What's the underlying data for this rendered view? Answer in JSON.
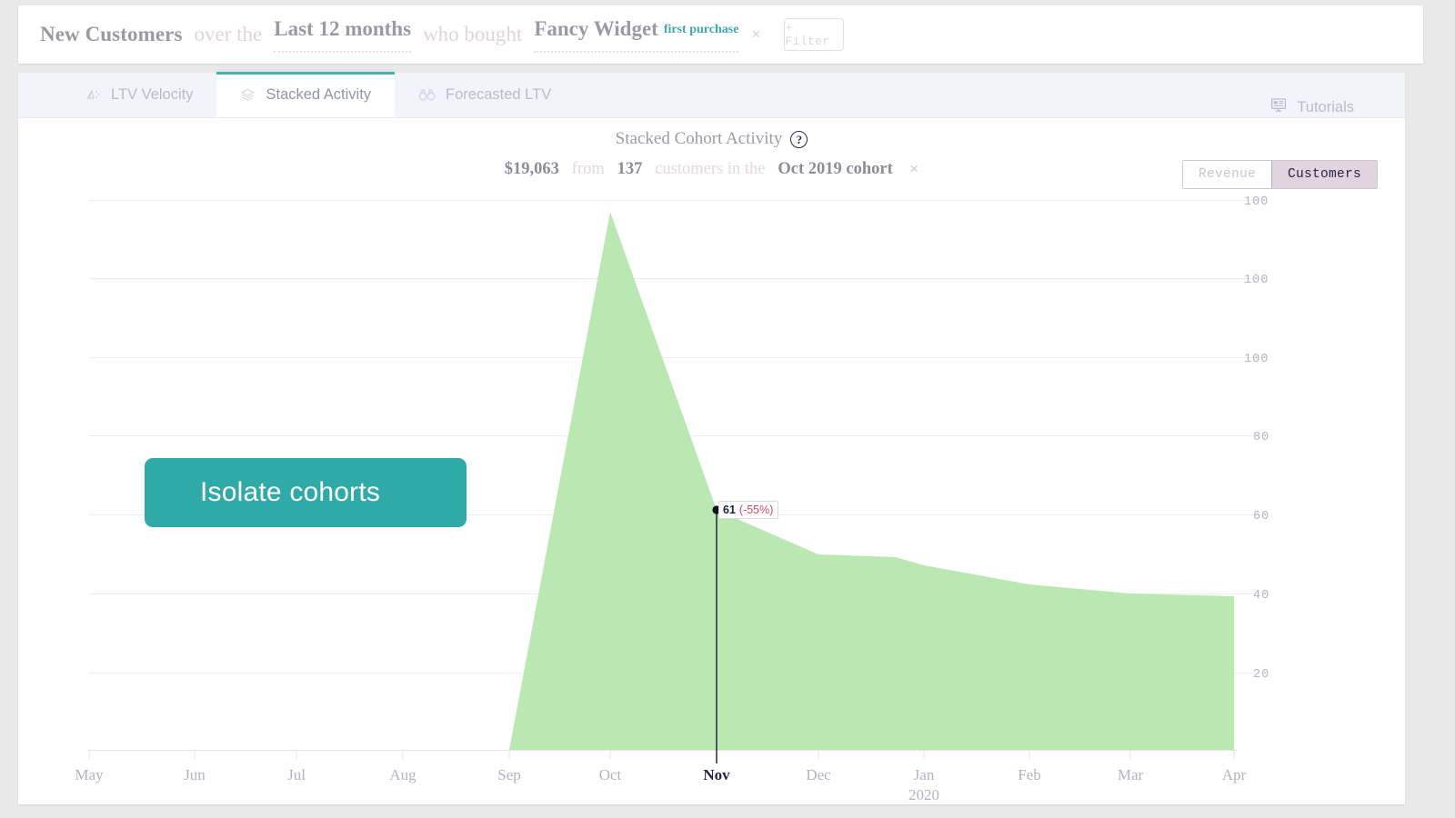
{
  "query_bar": {
    "metric": "New Customers",
    "conn1": "over the",
    "period": "Last 12 months",
    "conn2": "who bought",
    "product": "Fancy Widget",
    "product_sub": "first purchase",
    "remove": "×",
    "filter_button": "+ Filter"
  },
  "tabs": {
    "items": [
      {
        "label": "LTV Velocity",
        "icon": "ltv-velocity-icon",
        "active": false
      },
      {
        "label": "Stacked Activity",
        "icon": "layers-icon",
        "active": true
      },
      {
        "label": "Forecasted LTV",
        "icon": "binoculars-icon",
        "active": false
      }
    ],
    "right": {
      "label": "Tutorials",
      "icon": "monitor-icon"
    }
  },
  "chart_header": {
    "title": "Stacked Cohort Activity",
    "help_icon": "question-mark-icon",
    "help_glyph": "?",
    "subtitle": {
      "amount": "$19,063",
      "from": "from",
      "count": "137",
      "middle": "customers in the",
      "cohort": "Oct 2019 cohort",
      "remove": "×"
    }
  },
  "toggle": {
    "options": [
      "Revenue",
      "Customers"
    ],
    "selected": "Customers"
  },
  "overlay": {
    "isolate_pill": "Isolate cohorts",
    "pill_color": "#30aaa7",
    "tooltip": {
      "value": "61",
      "change": "(-55%)",
      "change_color": "#d4466a"
    }
  },
  "chart_data": {
    "type": "area",
    "title": "Stacked Cohort Activity",
    "xlabel": "",
    "ylabel": "",
    "series_name": "Oct 2019 cohort",
    "fill_color": "#bbe7b3",
    "x": [
      "May",
      "Jun",
      "Jul",
      "Aug",
      "Sep",
      "Oct",
      "Nov",
      "Dec",
      "Jan",
      "Feb",
      "Mar",
      "Apr"
    ],
    "x_year_label": "2020",
    "x_year_under": "Jan",
    "x_highlight": "Nov",
    "values": [
      0,
      0,
      0,
      0,
      0,
      136,
      61,
      53,
      52,
      46,
      43,
      41
    ],
    "ytick_labels": [
      "100",
      "100",
      "100",
      "80",
      "60",
      "40",
      "20"
    ],
    "ytick_values": [
      100,
      100,
      100,
      80,
      60,
      40,
      20
    ],
    "grid": true,
    "legend": "none",
    "annotations": [
      {
        "x": "Nov",
        "value": "61",
        "change": "(-55%)"
      }
    ]
  }
}
